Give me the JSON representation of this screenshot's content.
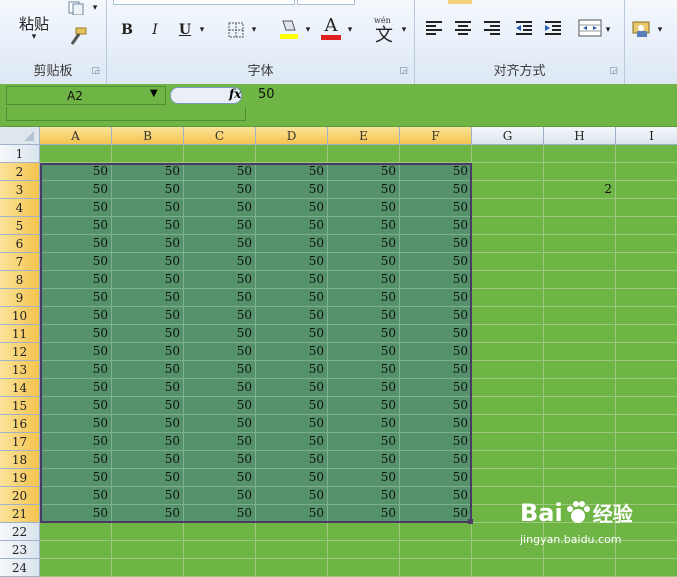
{
  "ribbon": {
    "clipboard": {
      "label": "剪贴板",
      "paste_label": "粘贴"
    },
    "font": {
      "label": "字体",
      "bold": "B",
      "italic": "I",
      "underline": "U",
      "font_color": "A"
    },
    "alignment": {
      "label": "对齐方式"
    }
  },
  "formula_bar": {
    "name_box": "A2",
    "fx": "fx",
    "value": "50"
  },
  "columns": [
    "A",
    "B",
    "C",
    "D",
    "E",
    "F",
    "G",
    "H",
    "I"
  ],
  "rows": [
    "1",
    "2",
    "3",
    "4",
    "5",
    "6",
    "7",
    "8",
    "9",
    "10",
    "11",
    "12",
    "13",
    "14",
    "15",
    "16",
    "17",
    "18",
    "19",
    "20",
    "21",
    "22",
    "23",
    "24"
  ],
  "cell_value": "50",
  "h3_value": "2",
  "watermark": {
    "brand": "Bai",
    "brand2": "经验",
    "url": "jingyan.baidu.com"
  },
  "colors": {
    "sheet_green": "#6fb545",
    "selection_fill": "#55926c",
    "header_selected": "#f5c34e"
  }
}
